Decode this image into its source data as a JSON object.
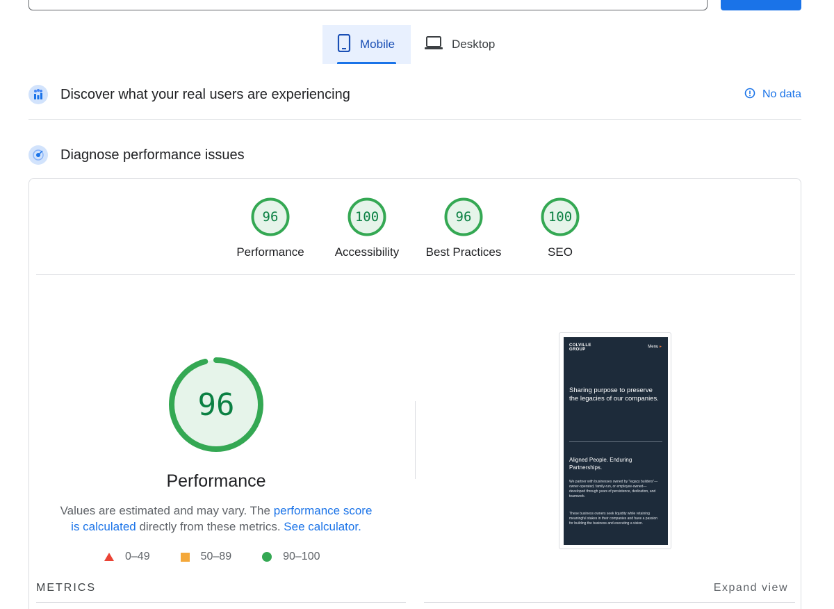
{
  "tabs": {
    "mobile": "Mobile",
    "desktop": "Desktop"
  },
  "field_data": {
    "title": "Discover what your real users are experiencing",
    "status": "No data"
  },
  "diagnose": {
    "title": "Diagnose performance issues"
  },
  "scores": [
    {
      "label": "Performance",
      "value": "96"
    },
    {
      "label": "Accessibility",
      "value": "100"
    },
    {
      "label": "Best Practices",
      "value": "96"
    },
    {
      "label": "SEO",
      "value": "100"
    }
  ],
  "performance": {
    "score": "96",
    "score_fraction": 0.96,
    "title": "Performance",
    "desc_prefix": "Values are estimated and may vary. The ",
    "desc_link1": "performance score is calculated",
    "desc_middle": " directly from these metrics. ",
    "desc_link2": "See calculator."
  },
  "legend": {
    "fail": "0–49",
    "average": "50–89",
    "pass": "90–100"
  },
  "metrics": {
    "label": "METRICS",
    "expand": "Expand view"
  },
  "screenshot": {
    "logo": "COLVILLE GROUP",
    "menu": "Menu",
    "headline": "Sharing purpose to preserve the legacies of our companies.",
    "subhead": "Aligned People. Enduring Partnerships.",
    "para1": "We partner with businesses owned by “legacy builders”—owner-operated, family-run, or employee-owned—developed through years of persistence, dedication, and teamwork.",
    "para2": "These business owners seek liquidity while retaining meaningful stakes in their companies and have a passion for building the business and executing a vision."
  },
  "colors": {
    "pass": "#0b8043",
    "pass_ring": "#34a853",
    "pass_fill": "#e6f4ea",
    "link": "#1a73e8"
  }
}
